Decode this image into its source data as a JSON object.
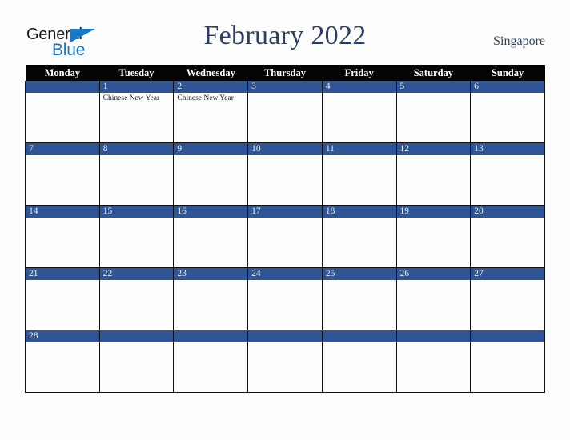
{
  "brand": {
    "name_part1": "General",
    "name_part2": "Blue",
    "triangle_icon": "triangle-icon",
    "color_dark": "#1a1a1a",
    "color_blue": "#1878c8"
  },
  "header": {
    "title": "February 2022",
    "country": "Singapore",
    "title_color": "#2c3e63"
  },
  "theme": {
    "header_row_background": "#050505",
    "day_bar_background": "#2f5596",
    "day_number_color": "#e8ecf5",
    "cell_background": "#fdfdfd",
    "page_background": "#fdfdfd",
    "grid_line_color": "#111111"
  },
  "weekdays": [
    "Monday",
    "Tuesday",
    "Wednesday",
    "Thursday",
    "Friday",
    "Saturday",
    "Sunday"
  ],
  "weeks": [
    [
      {
        "date": "",
        "events": []
      },
      {
        "date": "1",
        "events": [
          "Chinese New Year"
        ]
      },
      {
        "date": "2",
        "events": [
          "Chinese New Year"
        ]
      },
      {
        "date": "3",
        "events": []
      },
      {
        "date": "4",
        "events": []
      },
      {
        "date": "5",
        "events": []
      },
      {
        "date": "6",
        "events": []
      }
    ],
    [
      {
        "date": "7",
        "events": []
      },
      {
        "date": "8",
        "events": []
      },
      {
        "date": "9",
        "events": []
      },
      {
        "date": "10",
        "events": []
      },
      {
        "date": "11",
        "events": []
      },
      {
        "date": "12",
        "events": []
      },
      {
        "date": "13",
        "events": []
      }
    ],
    [
      {
        "date": "14",
        "events": []
      },
      {
        "date": "15",
        "events": []
      },
      {
        "date": "16",
        "events": []
      },
      {
        "date": "17",
        "events": []
      },
      {
        "date": "18",
        "events": []
      },
      {
        "date": "19",
        "events": []
      },
      {
        "date": "20",
        "events": []
      }
    ],
    [
      {
        "date": "21",
        "events": []
      },
      {
        "date": "22",
        "events": []
      },
      {
        "date": "23",
        "events": []
      },
      {
        "date": "24",
        "events": []
      },
      {
        "date": "25",
        "events": []
      },
      {
        "date": "26",
        "events": []
      },
      {
        "date": "27",
        "events": []
      }
    ],
    [
      {
        "date": "28",
        "events": []
      },
      {
        "date": "",
        "events": []
      },
      {
        "date": "",
        "events": []
      },
      {
        "date": "",
        "events": []
      },
      {
        "date": "",
        "events": []
      },
      {
        "date": "",
        "events": []
      },
      {
        "date": "",
        "events": []
      }
    ]
  ]
}
